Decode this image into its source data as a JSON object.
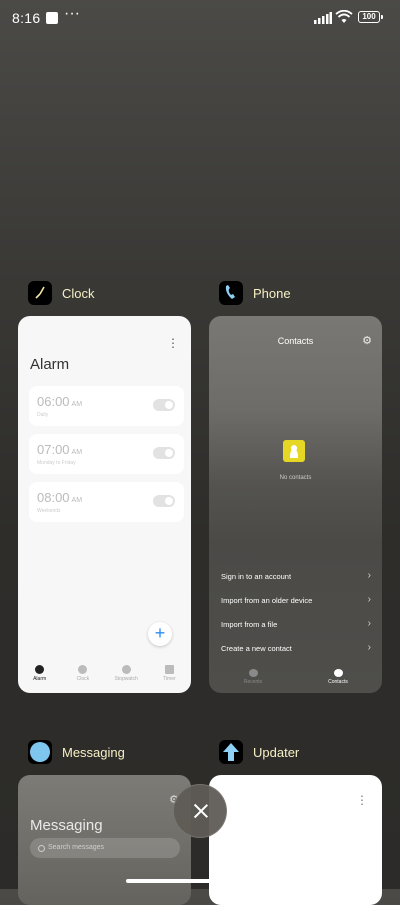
{
  "status_bar": {
    "time": "8:16",
    "more": "···",
    "battery": "100"
  },
  "apps": [
    {
      "name": "Clock"
    },
    {
      "name": "Phone"
    },
    {
      "name": "Messaging"
    },
    {
      "name": "Updater"
    }
  ],
  "clock_card": {
    "menu": "⋮",
    "title": "Alarm",
    "alarms": [
      {
        "time": "06:00",
        "ampm": "AM",
        "label": "Daily"
      },
      {
        "time": "07:00",
        "ampm": "AM",
        "label": "Monday to Friday"
      },
      {
        "time": "08:00",
        "ampm": "AM",
        "label": "Weekends"
      }
    ],
    "fab": "+",
    "tabs": [
      "Alarm",
      "Clock",
      "Stopwatch",
      "Timer"
    ]
  },
  "phone_card": {
    "title": "Contacts",
    "gear": "⚙",
    "empty_text": "No contacts",
    "options": [
      "Sign in to an account",
      "Import from an older device",
      "Import from a file",
      "Create a new contact"
    ],
    "chevron": "›",
    "tabs": [
      "Recents",
      "Contacts"
    ]
  },
  "messaging_card": {
    "title": "Messaging",
    "gear": "⚙",
    "search_placeholder": "Search messages"
  },
  "updater_card": {
    "menu": "⋮"
  },
  "colors": {
    "app_label": "#f6f0c6",
    "fab_plus": "#2a8bf2",
    "contact_icon": "#e7d725"
  }
}
